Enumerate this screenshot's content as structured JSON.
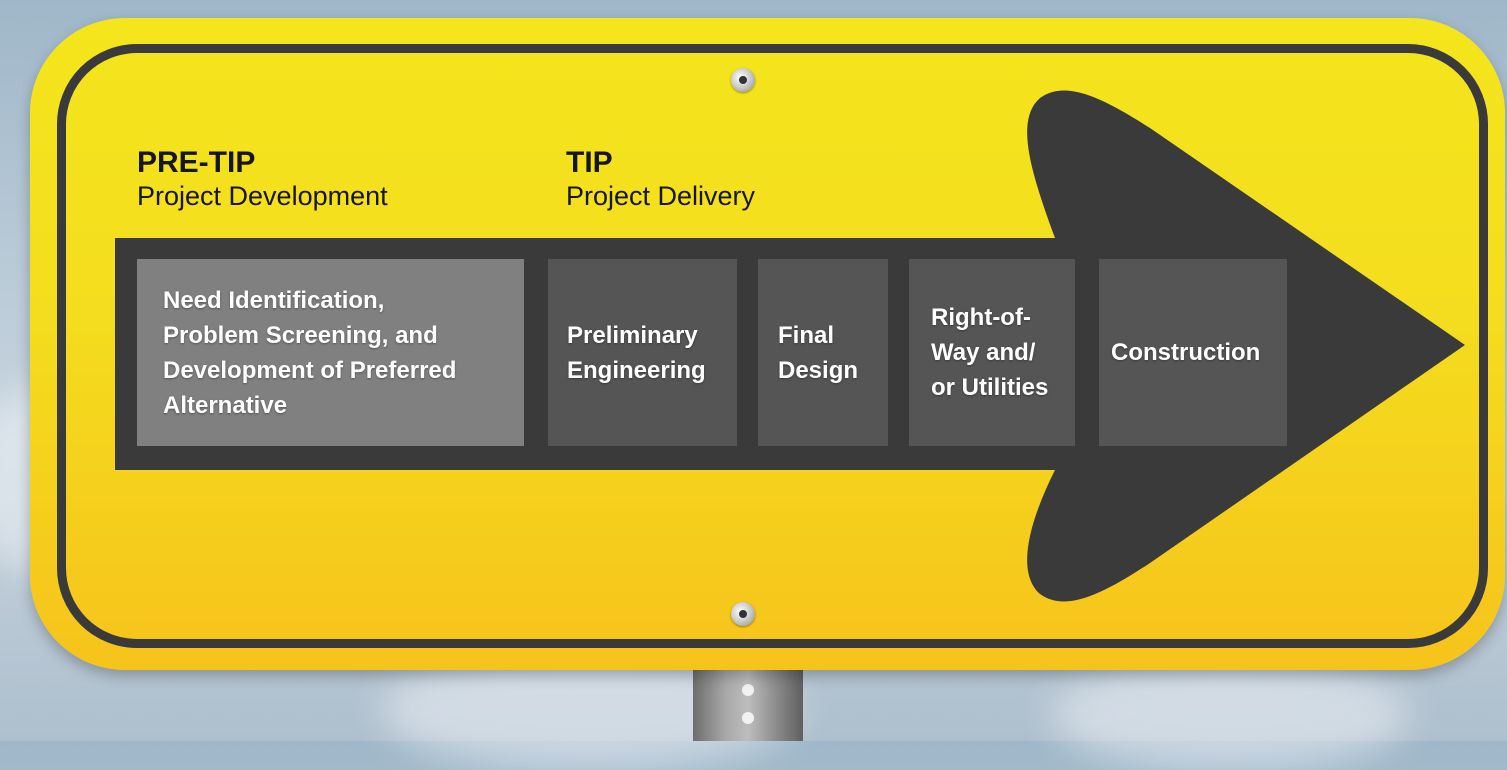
{
  "pre_tip": {
    "title": "PRE-TIP",
    "subtitle": "Project Development"
  },
  "tip": {
    "title": "TIP",
    "subtitle": "Project Delivery"
  },
  "stages": [
    {
      "label": "Need Identification,\nProblem Screening, and\nDevelopment of Preferred\nAlternative",
      "phase": "PRE-TIP"
    },
    {
      "label": "Preliminary\nEngineering",
      "phase": "TIP"
    },
    {
      "label": "Final\nDesign",
      "phase": "TIP"
    },
    {
      "label": "Right-of-\nWay and/\nor Utilities",
      "phase": "TIP"
    },
    {
      "label": "Construction",
      "phase": "TIP"
    }
  ],
  "colors": {
    "sign_yellow": "#f4dd1e",
    "arrow_dark": "#3a3a3a",
    "pre_tip_box": "#808080",
    "tip_box": "#555555",
    "text_white": "#ffffff"
  }
}
